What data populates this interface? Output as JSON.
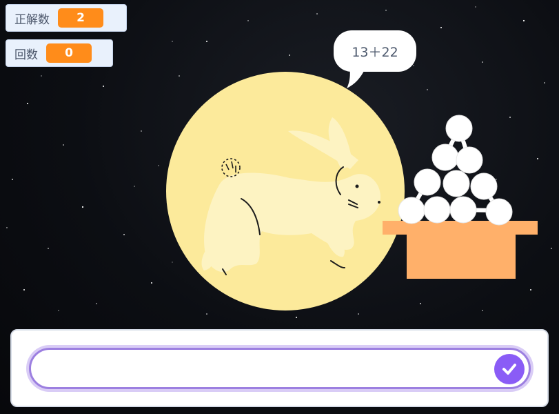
{
  "monitors": {
    "score": {
      "label": "正解数",
      "value": "2"
    },
    "count": {
      "label": "回数",
      "value": "0"
    }
  },
  "speech": {
    "text": "13＋22"
  },
  "answer": {
    "value": ""
  },
  "icons": {
    "submit": "check-icon",
    "moon": "full-moon",
    "rabbit": "rabbit",
    "dango": "tsukimi-dango-stand"
  },
  "colors": {
    "monitor_value": "#ff8c1a",
    "moon": "#fcea9b",
    "rabbit": "#fdf3c2",
    "stand": "#ffb06a",
    "input_border": "#9c7fe0",
    "submit": "#8a5cf6"
  }
}
